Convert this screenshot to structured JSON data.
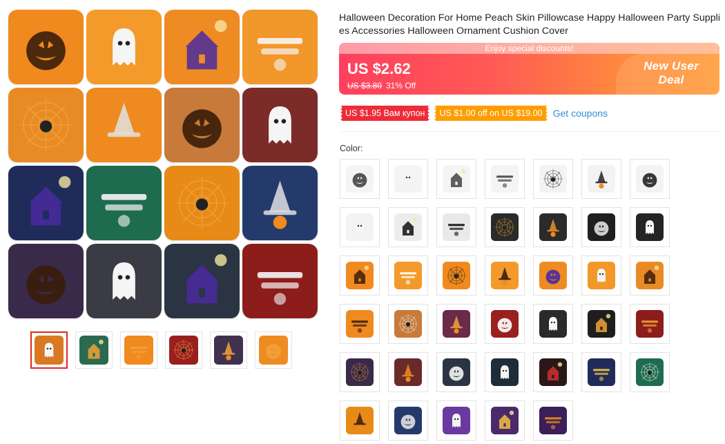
{
  "product": {
    "title": "Halloween Decoration For Home Peach Skin Pillowcase Happy Halloween Party Supplies Accessories Halloween Ornament Cushion Cover",
    "promo_banner": "Enjoy special discounts!",
    "price_now": "US $2.62",
    "price_old": "US $3.80",
    "discount": "31% Off",
    "new_user_badge_line1": "New User",
    "new_user_badge_line2": "Deal"
  },
  "coupons": {
    "coupon1": "US $1.95 Вам купон",
    "coupon2": "US $1.00 off on US $19.00",
    "get_link": "Get coupons"
  },
  "color_label": "Color:",
  "gallery": {
    "tiles": [
      {
        "bg": "#f08a1e",
        "motif": "pumpkins"
      },
      {
        "bg": "#f39a2a",
        "motif": "spider"
      },
      {
        "bg": "#ef8b23",
        "motif": "witch-pumpkin"
      },
      {
        "bg": "#f2972a",
        "motif": "girl"
      },
      {
        "bg": "#e98b25",
        "motif": "hat"
      },
      {
        "bg": "#ee8a20",
        "motif": "pumpkin-face"
      },
      {
        "bg": "#c77a3a",
        "motif": "ghost-trick"
      },
      {
        "bg": "#7c2c28",
        "motif": "happy-halloween"
      },
      {
        "bg": "#1f2c5a",
        "motif": "castle"
      },
      {
        "bg": "#1f6b4f",
        "motif": "ghost-graves"
      },
      {
        "bg": "#e78a18",
        "motif": "tree"
      },
      {
        "bg": "#233a6b",
        "motif": "haunted-house"
      },
      {
        "bg": "#3a2a4a",
        "motif": "scarecrow"
      },
      {
        "bg": "#3b3b45",
        "motif": "hand"
      },
      {
        "bg": "#2b3442",
        "motif": "pumpkin-dark"
      },
      {
        "bg": "#8c1d1a",
        "motif": "window"
      }
    ]
  },
  "thumbnails": [
    {
      "bg": "#d97a22",
      "active": true
    },
    {
      "bg": "#2b6a4f",
      "active": false
    },
    {
      "bg": "#f08a1e",
      "active": false
    },
    {
      "bg": "#9a1f1f",
      "active": false
    },
    {
      "bg": "#41304e",
      "active": false
    },
    {
      "bg": "#ef8b23",
      "active": false
    }
  ],
  "swatches": [
    {
      "bg": "#f4f4f4",
      "fg": "#444"
    },
    {
      "bg": "#f4f4f4",
      "fg": "#444"
    },
    {
      "bg": "#f4f4f4",
      "fg": "#444"
    },
    {
      "bg": "#f4f4f4",
      "fg": "#444"
    },
    {
      "bg": "#f3f3f3",
      "fg": "#222"
    },
    {
      "bg": "#f3f3f3",
      "fg": "#222"
    },
    {
      "bg": "#f3f3f3",
      "fg": "#222"
    },
    {
      "bg": "#f3f3f3",
      "fg": "#222"
    },
    {
      "bg": "#ececec",
      "fg": "#111"
    },
    {
      "bg": "#e9e9e9",
      "fg": "#111"
    },
    {
      "bg": "#2a2a2a",
      "fg": "#e8a12a"
    },
    {
      "bg": "#2b2b2b",
      "fg": "#e88f2a"
    },
    {
      "bg": "#1f1f1f",
      "fg": "#e0e0e0"
    },
    {
      "bg": "#242424",
      "fg": "#f0a23a"
    },
    {
      "bg": "#f08a1e",
      "fg": "#3a1d0a"
    },
    {
      "bg": "#f39a2a",
      "fg": "#ffffff"
    },
    {
      "bg": "#f08a1e",
      "fg": "#2a1a10"
    },
    {
      "bg": "#f39a2a",
      "fg": "#2a1a10"
    },
    {
      "bg": "#ef8b23",
      "fg": "#4a2aa0"
    },
    {
      "bg": "#f2972a",
      "fg": "#3a1d0a"
    },
    {
      "bg": "#e98b25",
      "fg": "#3a1d0a"
    },
    {
      "bg": "#ee8a20",
      "fg": "#3a1d0a"
    },
    {
      "bg": "#c77a3a",
      "fg": "#f4f4f4"
    },
    {
      "bg": "#6a2a4a",
      "fg": "#f0a23a"
    },
    {
      "bg": "#9a1f1f",
      "fg": "#ffffff"
    },
    {
      "bg": "#2a2a2a",
      "fg": "#f08a1e"
    },
    {
      "bg": "#1e1e1e",
      "fg": "#f0a23a"
    },
    {
      "bg": "#8c1d1a",
      "fg": "#f0a23a"
    },
    {
      "bg": "#3a2a4a",
      "fg": "#e08a2a"
    },
    {
      "bg": "#6a2a2a",
      "fg": "#f08a1e"
    },
    {
      "bg": "#2b3442",
      "fg": "#f4f4f4"
    },
    {
      "bg": "#1f2c3a",
      "fg": "#e0e0e0"
    },
    {
      "bg": "#2a1818",
      "fg": "#d03030"
    },
    {
      "bg": "#1f2c5a",
      "fg": "#f0c040"
    },
    {
      "bg": "#1f6b4f",
      "fg": "#ffffff"
    },
    {
      "bg": "#e78a18",
      "fg": "#3a1d0a"
    },
    {
      "bg": "#233a6b",
      "fg": "#e0e0e0"
    },
    {
      "bg": "#6a3aa0",
      "fg": "#f08a1e"
    },
    {
      "bg": "#4a2a6a",
      "fg": "#f0c040"
    },
    {
      "bg": "#3a1f5a",
      "fg": "#f08a1e"
    }
  ]
}
